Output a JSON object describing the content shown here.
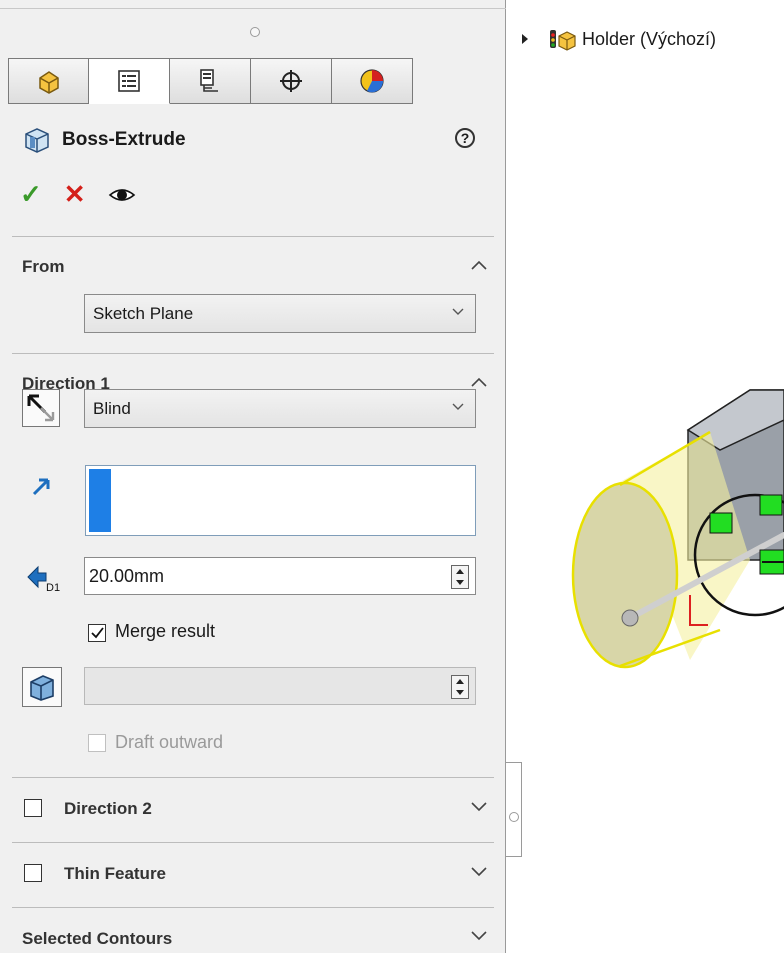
{
  "feature": {
    "title": "Boss-Extrude",
    "help_symbol": "?"
  },
  "tabs": [
    {
      "icon": "feature-manager-icon"
    },
    {
      "icon": "property-manager-icon"
    },
    {
      "icon": "configuration-manager-icon"
    },
    {
      "icon": "dimxpert-manager-icon"
    },
    {
      "icon": "display-manager-icon"
    }
  ],
  "actions": {
    "ok_symbol": "✓",
    "cancel_symbol": "✕",
    "preview_icon": "eye-icon"
  },
  "from": {
    "label": "From",
    "value": "Sketch Plane"
  },
  "direction1": {
    "label": "Direction 1",
    "end_condition": "Blind",
    "depth": "20.00mm",
    "merge_result_label": "Merge result",
    "merge_result_checked": true,
    "draft_value": "",
    "draft_outward_label": "Draft outward",
    "draft_outward_checked": false
  },
  "direction2": {
    "label": "Direction 2",
    "checked": false
  },
  "thin_feature": {
    "label": "Thin Feature",
    "checked": false
  },
  "selected_contours": {
    "label": "Selected Contours"
  },
  "tree": {
    "root_label": "Holder  (Výchozí)"
  },
  "colors": {
    "accent_blue": "#1e7fe6",
    "ok_green": "#3a9a2a",
    "cancel_red": "#d4201a",
    "highlight_yellow": "#f5f0a0"
  }
}
